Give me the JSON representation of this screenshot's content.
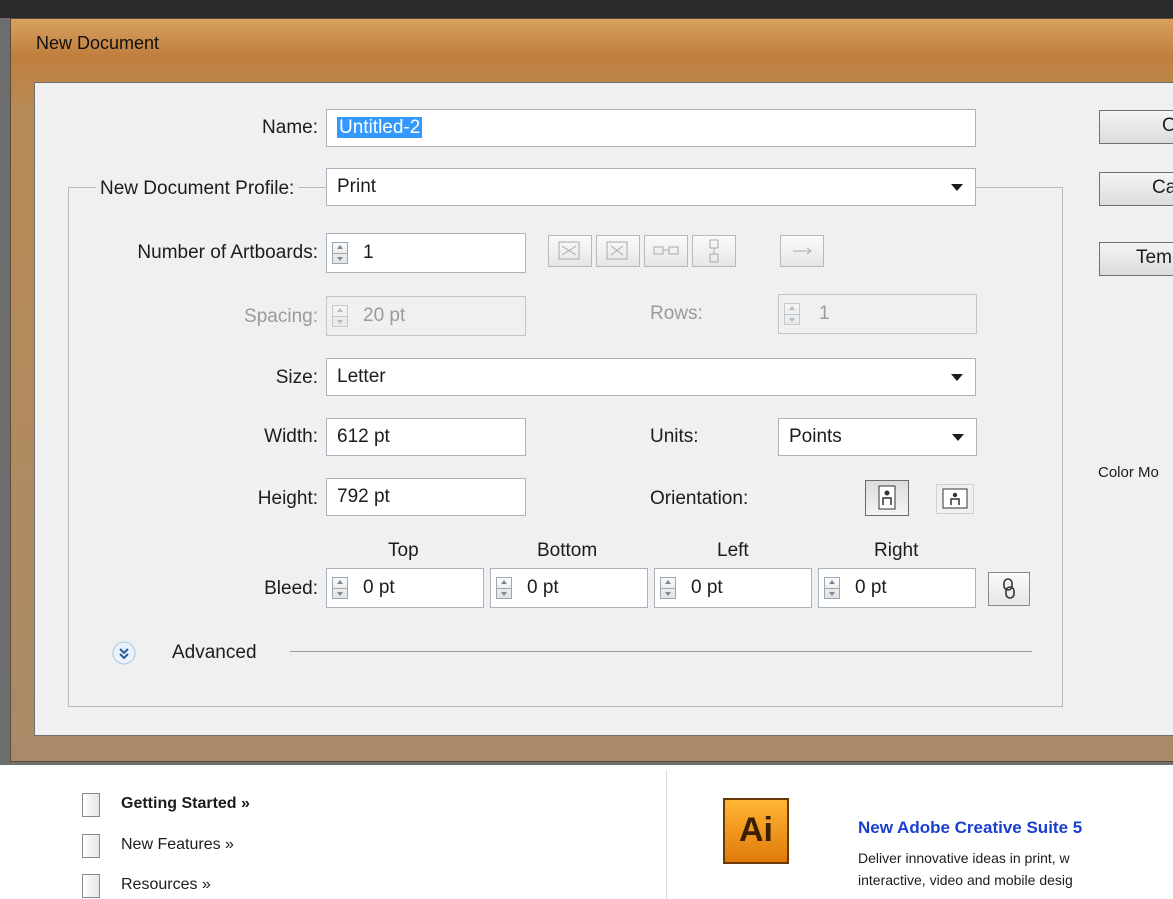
{
  "window": {
    "title": "New Document"
  },
  "form": {
    "name_label": "Name:",
    "name_value": "Untitled-2",
    "profile_label": "New Document Profile:",
    "profile_value": "Print",
    "artboards_label": "Number of Artboards:",
    "artboards_value": "1",
    "spacing_label": "Spacing:",
    "spacing_value": "20 pt",
    "rows_label": "Rows:",
    "rows_value": "1",
    "size_label": "Size:",
    "size_value": "Letter",
    "width_label": "Width:",
    "width_value": "612 pt",
    "units_label": "Units:",
    "units_value": "Points",
    "height_label": "Height:",
    "height_value": "792 pt",
    "orientation_label": "Orientation:",
    "bleed_label": "Bleed:",
    "bleed_top_label": "Top",
    "bleed_bottom_label": "Bottom",
    "bleed_left_label": "Left",
    "bleed_right_label": "Right",
    "bleed_top": "0 pt",
    "bleed_bottom": "0 pt",
    "bleed_left": "0 pt",
    "bleed_right": "0 pt",
    "advanced_label": "Advanced"
  },
  "buttons": {
    "ok": "OK",
    "cancel": "Ca",
    "templates": "Temp"
  },
  "side": {
    "color_mode_label": "Color Mo"
  },
  "welcome": {
    "links": [
      "Getting Started »",
      "New Features »",
      "Resources »"
    ],
    "logo_text": "Ai",
    "headline": "New Adobe Creative Suite 5",
    "desc_line1": "Deliver innovative ideas in print, w",
    "desc_line2": "interactive, video and mobile desig"
  },
  "colors": {
    "title_bar": "#c07f3e",
    "link_blue": "#1a3fd0",
    "logo_orange": "#f08a10",
    "selection": "#3399ff"
  }
}
